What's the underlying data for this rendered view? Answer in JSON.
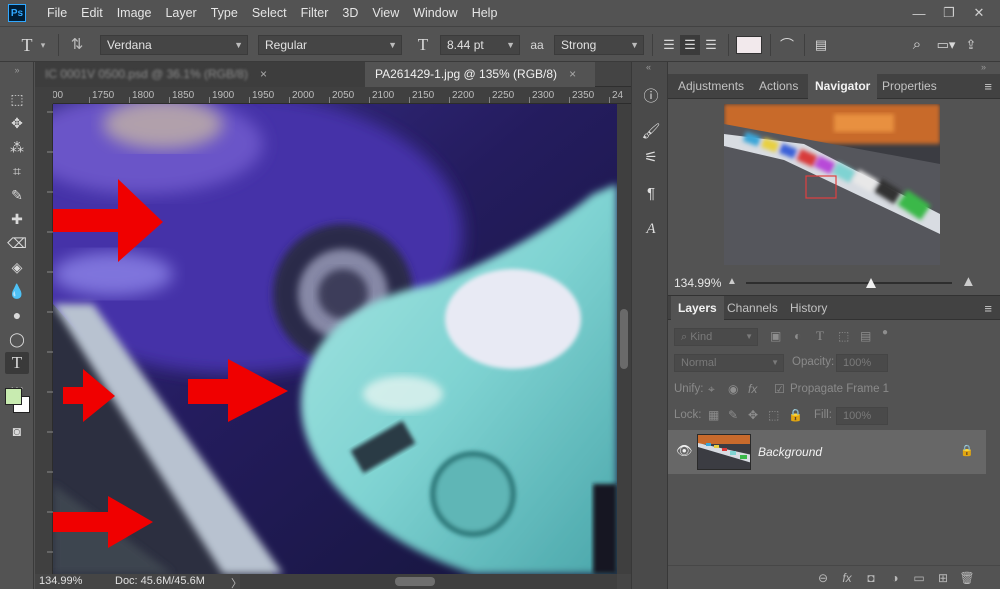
{
  "menu": {
    "logo": "Ps",
    "items": [
      "File",
      "Edit",
      "Image",
      "Layer",
      "Type",
      "Select",
      "Filter",
      "3D",
      "View",
      "Window",
      "Help"
    ]
  },
  "window_controls": {
    "minimize": "—",
    "restore": "❐",
    "close": "✕"
  },
  "options_bar": {
    "tool_icon": "T",
    "font_family": "Verdana",
    "font_style": "Regular",
    "font_size": "8.44 pt",
    "aa_icon": "aa",
    "antialias": "Strong",
    "text_color": "#f2e9ec"
  },
  "document": {
    "tabs": [
      {
        "label": "IC 0001V 0500.psd @ 36.1% (RGB/8)",
        "active": false
      },
      {
        "label": "PA261429-1.jpg @ 135% (RGB/8)",
        "active": true
      }
    ],
    "ruler_ticks": [
      "00",
      "1750",
      "1800",
      "1850",
      "1900",
      "1950",
      "2000",
      "2050",
      "2100",
      "2150",
      "2200",
      "2250",
      "2300",
      "2350",
      "24"
    ],
    "zoom": "134.99%",
    "doc_size": "Doc: 45.6M/45.6M",
    "status_arrow": "〉"
  },
  "colors": {
    "foreground": "#c8ebb0",
    "background": "#ffffff",
    "arrow": "#f00000"
  },
  "navigator_panel": {
    "tabs": [
      "Adjustments",
      "Actions",
      "Navigator",
      "Properties"
    ],
    "active_tab": "Navigator",
    "zoom": "134.99%"
  },
  "layers_panel": {
    "tabs": [
      "Layers",
      "Channels",
      "History"
    ],
    "active_tab": "Layers",
    "kind_placeholder": "Kind",
    "blend_mode": "Normal",
    "opacity_label": "Opacity:",
    "opacity_value": "100%",
    "unify_label": "Unify:",
    "propagate_label": "Propagate Frame 1",
    "lock_label": "Lock:",
    "fill_label": "Fill:",
    "fill_value": "100%",
    "layers": [
      {
        "name": "Background",
        "visible": true,
        "locked": true
      }
    ]
  }
}
